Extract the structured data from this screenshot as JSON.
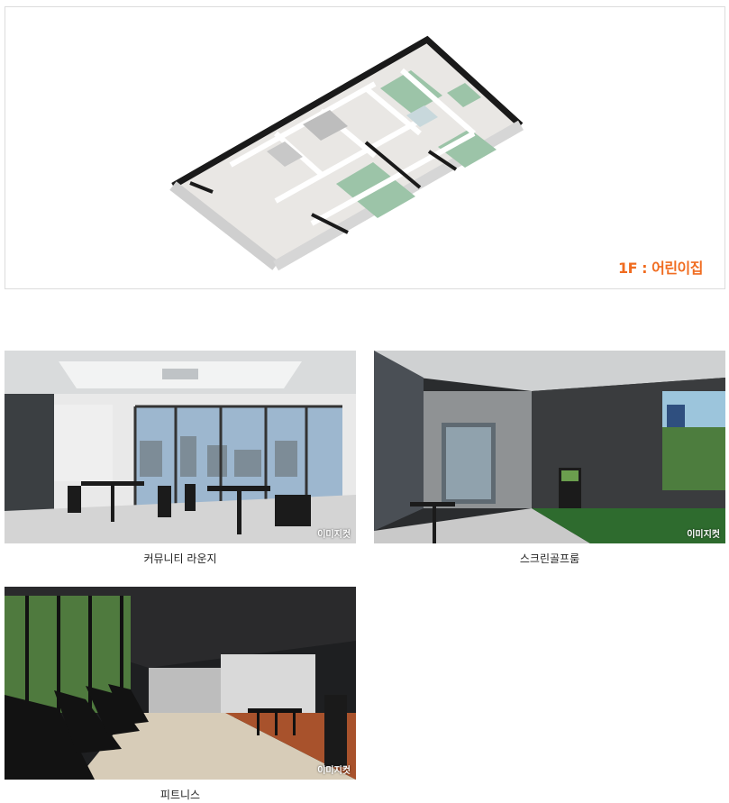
{
  "floor_plan": {
    "label": "1F : 어린이집",
    "label_color": "#f06c20"
  },
  "photos": [
    {
      "id": "lounge",
      "caption": "커뮤니티 라운지",
      "watermark": "이미지컷"
    },
    {
      "id": "golf",
      "caption": "스크린골프룸",
      "watermark": "이미지컷"
    },
    {
      "id": "fitness",
      "caption": "피트니스",
      "watermark": "이미지컷"
    }
  ]
}
